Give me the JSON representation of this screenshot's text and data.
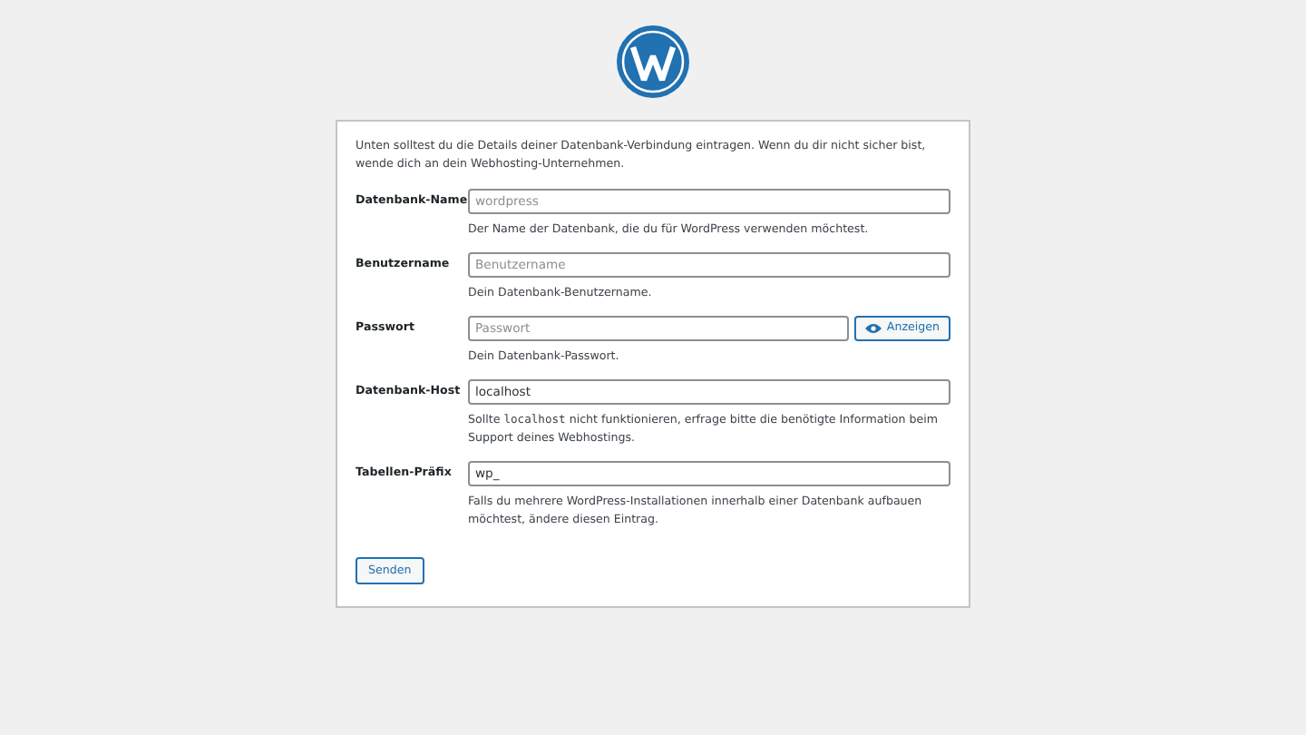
{
  "intro": "Unten solltest du die Details deiner Datenbank-Verbindung eintragen. Wenn du dir nicht sicher bist, wende dich an dein Webhosting-Unternehmen.",
  "fields": [
    {
      "label": "Datenbank-Name",
      "placeholder": "wordpress",
      "help": [
        {
          "kind": "text",
          "text": "Der Name der Datenbank, die du für WordPress verwenden möchtest."
        }
      ]
    },
    {
      "label": "Benutzername",
      "placeholder": "Benutzername",
      "help": [
        {
          "kind": "text",
          "text": "Dein Datenbank-Benutzername."
        }
      ]
    },
    {
      "label": "Passwort",
      "placeholder": "Passwort",
      "toggle": "Anzeigen",
      "help": [
        {
          "kind": "text",
          "text": "Dein Datenbank-Passwort."
        }
      ]
    },
    {
      "label": "Datenbank-Host",
      "value": "localhost",
      "help": [
        {
          "kind": "text",
          "text": "Sollte "
        },
        {
          "kind": "code",
          "text": "localhost"
        },
        {
          "kind": "text",
          "text": " nicht funktionieren, erfrage bitte die benötigte Information beim Support deines Webhostings."
        }
      ]
    },
    {
      "label": "Tabellen-Präfix",
      "value": "wp_",
      "help": [
        {
          "kind": "text",
          "text": "Falls du mehrere WordPress-Installationen innerhalb einer Datenbank aufbauen möchtest, ändere diesen Eintrag."
        }
      ]
    }
  ],
  "submit": "Senden"
}
